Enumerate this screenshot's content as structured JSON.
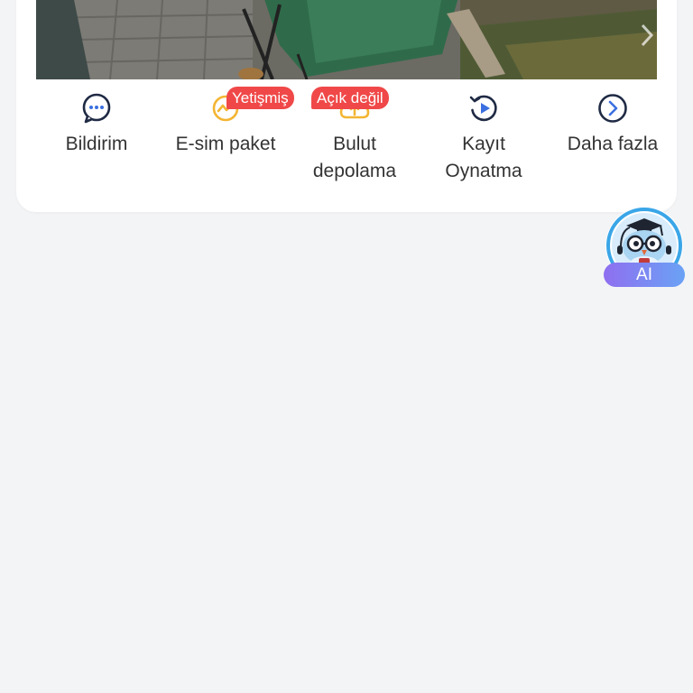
{
  "actions": [
    {
      "label": "Bildirim",
      "icon": "chat-bubble-icon",
      "color": "#1f2a44"
    },
    {
      "label": "E-sim paket",
      "icon": "esim-signal-icon",
      "color": "#f3b533",
      "badge": "Yetişmiş"
    },
    {
      "label": "Bulut\ndepolama",
      "icon": "cloud-upload-icon",
      "color": "#f3b533",
      "badge": "Açık değil"
    },
    {
      "label": "Kayıt\nOynatma",
      "icon": "replay-icon",
      "color": "#1f2a44"
    },
    {
      "label": "Daha fazla",
      "icon": "chevron-right-circle-icon",
      "color": "#1f2a44"
    }
  ],
  "ai_assistant": {
    "label": "AI",
    "icon": "robot-owl-icon"
  },
  "colors": {
    "background": "#f3f4f6",
    "card": "#ffffff",
    "badge": "#f04848",
    "ai_pill_start": "#8f6ff0",
    "ai_pill_end": "#6aa2f5"
  }
}
